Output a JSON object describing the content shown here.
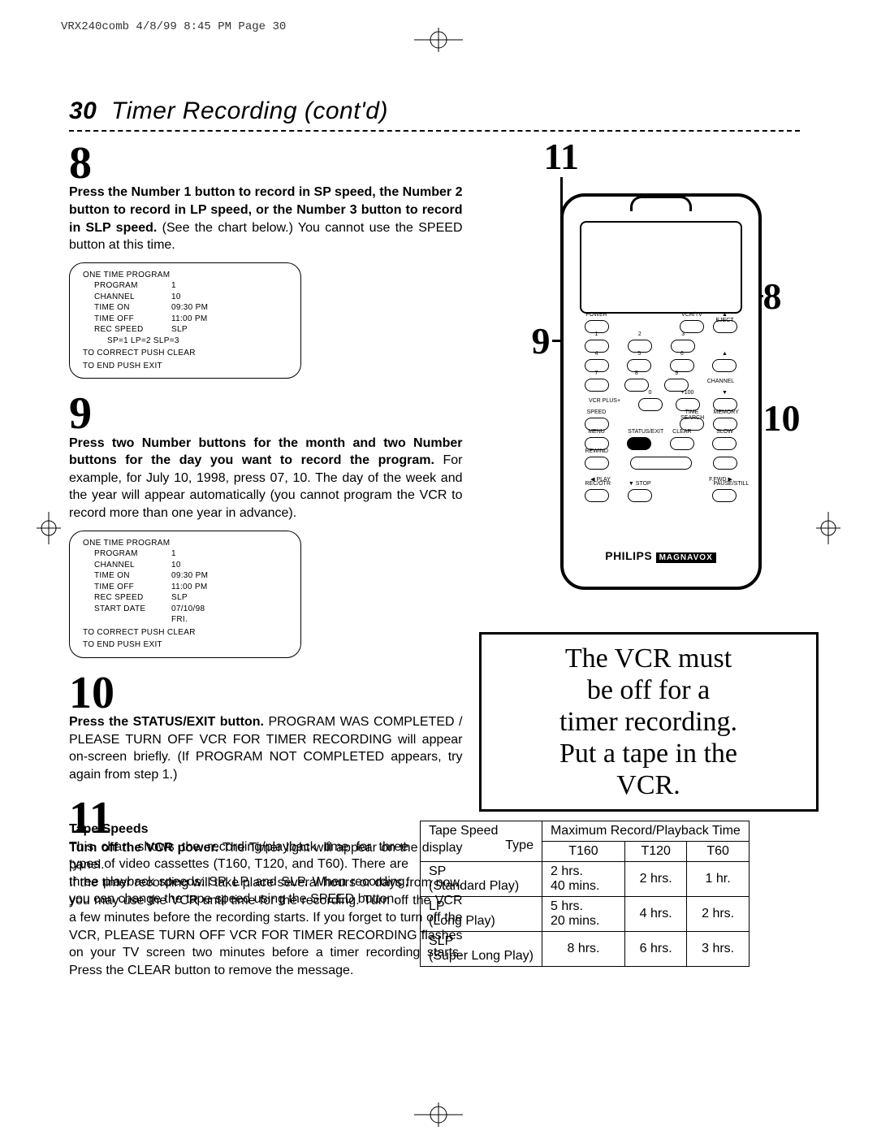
{
  "header_slug": "VRX240comb  4/8/99 8:45 PM  Page 30",
  "title_page_num": "30",
  "title": "Timer Recording (cont'd)",
  "left": {
    "step8": {
      "num": "8",
      "bold": "Press the Number 1 button to record in SP speed, the Number 2 button to record in LP speed, or the Number 3 button to record in SLP speed.",
      "rest": " (See the chart below.) You cannot use the SPEED button at this time."
    },
    "osd1": {
      "title": "ONE TIME PROGRAM",
      "rows": [
        [
          "PROGRAM",
          "1"
        ],
        [
          "CHANNEL",
          "10"
        ],
        [
          "TIME ON",
          "09:30 PM"
        ],
        [
          "TIME OFF",
          "11:00 PM"
        ],
        [
          "REC SPEED",
          "SLP"
        ]
      ],
      "speedline": "SP=1   LP=2   SLP=3",
      "f1": "TO CORRECT PUSH CLEAR",
      "f2": "TO END PUSH EXIT"
    },
    "step9": {
      "num": "9",
      "bold": "Press two Number buttons for the month and two Number buttons for the day you want to record the program.",
      "rest": " For example, for July 10, 1998, press 07, 10. The day of the week and the year will appear automatically (you cannot program the VCR to record more than one year in advance)."
    },
    "osd2": {
      "title": "ONE TIME PROGRAM",
      "rows": [
        [
          "PROGRAM",
          "1"
        ],
        [
          "CHANNEL",
          "10"
        ],
        [
          "TIME ON",
          "09:30 PM"
        ],
        [
          "TIME OFF",
          "11:00 PM"
        ],
        [
          "REC SPEED",
          "SLP"
        ],
        [
          "START DATE",
          "07/10/98"
        ],
        [
          "",
          "FRI."
        ]
      ],
      "f1": "TO CORRECT PUSH CLEAR",
      "f2": "TO END PUSH EXIT"
    },
    "step10": {
      "num": "10",
      "bold": "Press the STATUS/EXIT button.",
      "rest": " PROGRAM WAS COMPLETED / PLEASE TURN OFF VCR FOR TIMER RECORDING will appear on-screen briefly. (If PROGRAM NOT COMPLETED appears, try again from step 1.)"
    },
    "step11": {
      "num": "11",
      "bold": "Turn off the VCR power.",
      "rest1": " The Timer light will appear on the display panel.",
      "rest2": "If the timer recording will take place several hours or days from now, you may use the VCR until time for the recording. Turn off the VCR a few minutes before the recording starts. If you forget to turn off the VCR, PLEASE TURN OFF VCR FOR TIMER RECORDING flashes on your TV screen two minutes before a timer recording starts. Press the CLEAR button to remove the message."
    }
  },
  "right": {
    "callouts": {
      "c11": "11",
      "c8": "8",
      "c9": "9",
      "c10": "10"
    },
    "remote": {
      "row1": [
        "POWER",
        "",
        "",
        "VCR/TV",
        "▲ EJECT"
      ],
      "row2": [
        "1",
        "2",
        "3",
        ""
      ],
      "row3": [
        "4",
        "5",
        "6",
        "▲"
      ],
      "row4": [
        "7",
        "8",
        "9",
        "CHANNEL"
      ],
      "row5": [
        "VCR PLUS+",
        "0",
        "+100",
        "▼"
      ],
      "row6": [
        "SPEED",
        "",
        "",
        "TIME SEARCH",
        "MEMORY"
      ],
      "row7": [
        "MENU",
        "STATUS/EXIT",
        "CLEAR",
        "SLOW"
      ],
      "row8": [
        "REWIND",
        "",
        "",
        ""
      ],
      "row9": [
        "◀ PLAY",
        "",
        "",
        "F.FWD ▶"
      ],
      "row10": [
        "REC/OTR",
        "▼ STOP",
        "",
        "PAUSE/STILL"
      ],
      "brand1": "PHILIPS",
      "brand2": "MAGNAVOX"
    },
    "warn": {
      "l1": "The VCR must",
      "l2": "be off for a",
      "l3": "timer recording.",
      "l4": "Put a tape in the",
      "l5": "VCR."
    }
  },
  "tape": {
    "heading": "Tape Speeds",
    "para": "This chart shows the recording/playback time for three types of video cassettes (T160, T120, and T60). There are three playback speeds: SP, LP, and SLP. When recording, you can change the tape speed using the SPEED button.",
    "th_speed": "Tape Speed",
    "th_max": "Maximum Record/Playback Time",
    "th_type": "Type",
    "th_t160": "T160",
    "th_t120": "T120",
    "th_t60": "T60",
    "sp_l1": "SP",
    "sp_l2": "(Standard Play)",
    "sp_t160a": "2 hrs.",
    "sp_t160b": "40 mins.",
    "sp_t120": "2 hrs.",
    "sp_t60": "1 hr.",
    "lp_l1": "LP",
    "lp_l2": "(Long Play)",
    "lp_t160a": "5 hrs.",
    "lp_t160b": "20 mins.",
    "lp_t120": "4 hrs.",
    "lp_t60": "2 hrs.",
    "slp_l1": "SLP",
    "slp_l2": "(Super Long Play)",
    "slp_t160": "8 hrs.",
    "slp_t120": "6 hrs.",
    "slp_t60": "3 hrs."
  },
  "chart_data": {
    "type": "table",
    "title": "Tape Speeds — Maximum Record/Playback Time",
    "columns": [
      "Tape Speed Type",
      "T160",
      "T120",
      "T60"
    ],
    "rows": [
      [
        "SP (Standard Play)",
        "2 hrs. 40 mins.",
        "2 hrs.",
        "1 hr."
      ],
      [
        "LP (Long Play)",
        "5 hrs. 20 mins.",
        "4 hrs.",
        "2 hrs."
      ],
      [
        "SLP (Super Long Play)",
        "8 hrs.",
        "6 hrs.",
        "3 hrs."
      ]
    ]
  }
}
